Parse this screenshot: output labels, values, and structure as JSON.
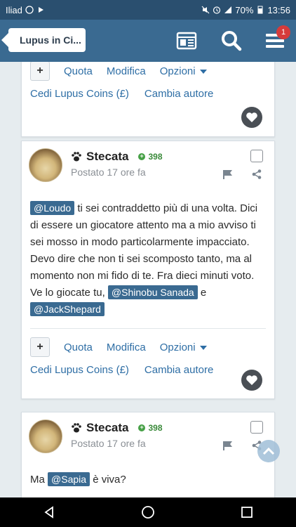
{
  "statusbar": {
    "carrier": "Iliad",
    "battery": "70%",
    "time": "13:56"
  },
  "header": {
    "back_label": "Lupus in Ci...",
    "notifications_count": "1"
  },
  "top_card": {
    "actions": {
      "quote": "Quota",
      "edit": "Modifica",
      "options": "Opzioni",
      "coins": "Cedi Lupus Coins (£)",
      "change_author": "Cambia autore"
    }
  },
  "posts": [
    {
      "author": "Stecata",
      "reputation": "398",
      "posted": "Postato 17 ore fa",
      "mention_1": "@Loudo",
      "text_1": " ti sei contraddetto più di una volta. Dici di essere un giocatore attento ma a mio avviso ti sei mosso in modo particolarmente impacciato. Devo dire che non ti sei scomposto tanto, ma al momento non mi fido di te. Fra dieci minuti voto. Ve lo giocate tu, ",
      "mention_2": "@Shinobu Sanada",
      "text_2": " e ",
      "mention_3": "@JackShepard",
      "actions": {
        "quote": "Quota",
        "edit": "Modifica",
        "options": "Opzioni",
        "coins": "Cedi Lupus Coins (£)",
        "change_author": "Cambia autore"
      }
    },
    {
      "author": "Stecata",
      "reputation": "398",
      "posted": "Postato 17 ore fa",
      "text_1": "Ma ",
      "mention_1": "@Sapia",
      "text_2": " è viva?"
    }
  ],
  "colors": {
    "header": "#3a6a91",
    "statusbar": "#2a4f6f",
    "link": "#2e6ea5",
    "mention_bg": "#3a6a91",
    "reputation": "#3a8a3a"
  }
}
